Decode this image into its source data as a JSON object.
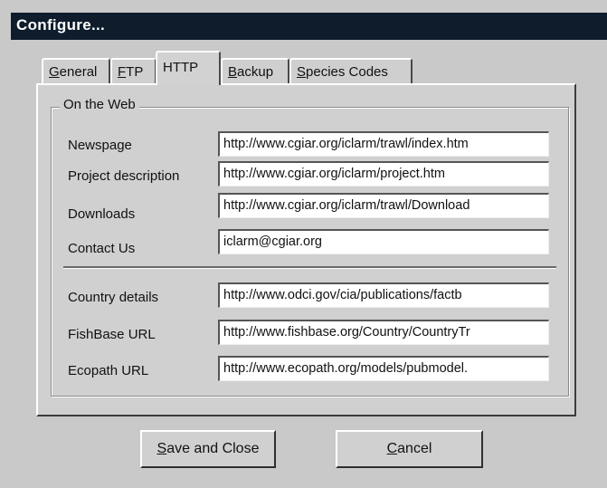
{
  "window": {
    "title": "Configure..."
  },
  "tabs": [
    {
      "acc": "G",
      "rest": "eneral",
      "active": false
    },
    {
      "acc": "F",
      "rest": "TP",
      "active": false
    },
    {
      "acc": "",
      "rest": "HTTP",
      "active": true
    },
    {
      "acc": "B",
      "rest": "ackup",
      "active": false
    },
    {
      "acc": "S",
      "rest": "pecies Codes",
      "active": false
    }
  ],
  "group": {
    "label": "On the Web"
  },
  "fields": [
    {
      "label": "Newspage",
      "value": "http://www.cgiar.org/iclarm/trawl/index.htm"
    },
    {
      "label": "Project description",
      "value": "http://www.cgiar.org/iclarm/project.htm"
    },
    {
      "label": "Downloads",
      "value": "http://www.cgiar.org/iclarm/trawl/Download"
    },
    {
      "label": "Contact Us",
      "value": "iclarm@cgiar.org"
    },
    {
      "label": "Country details",
      "value": "http://www.odci.gov/cia/publications/factb"
    },
    {
      "label": "FishBase URL",
      "value": "http://www.fishbase.org/Country/CountryTr"
    },
    {
      "label": "Ecopath URL",
      "value": "http://www.ecopath.org/models/pubmodel."
    }
  ],
  "buttons": {
    "save": {
      "acc": "S",
      "rest": "ave and Close"
    },
    "cancel": {
      "acc": "C",
      "rest": "ancel"
    }
  }
}
